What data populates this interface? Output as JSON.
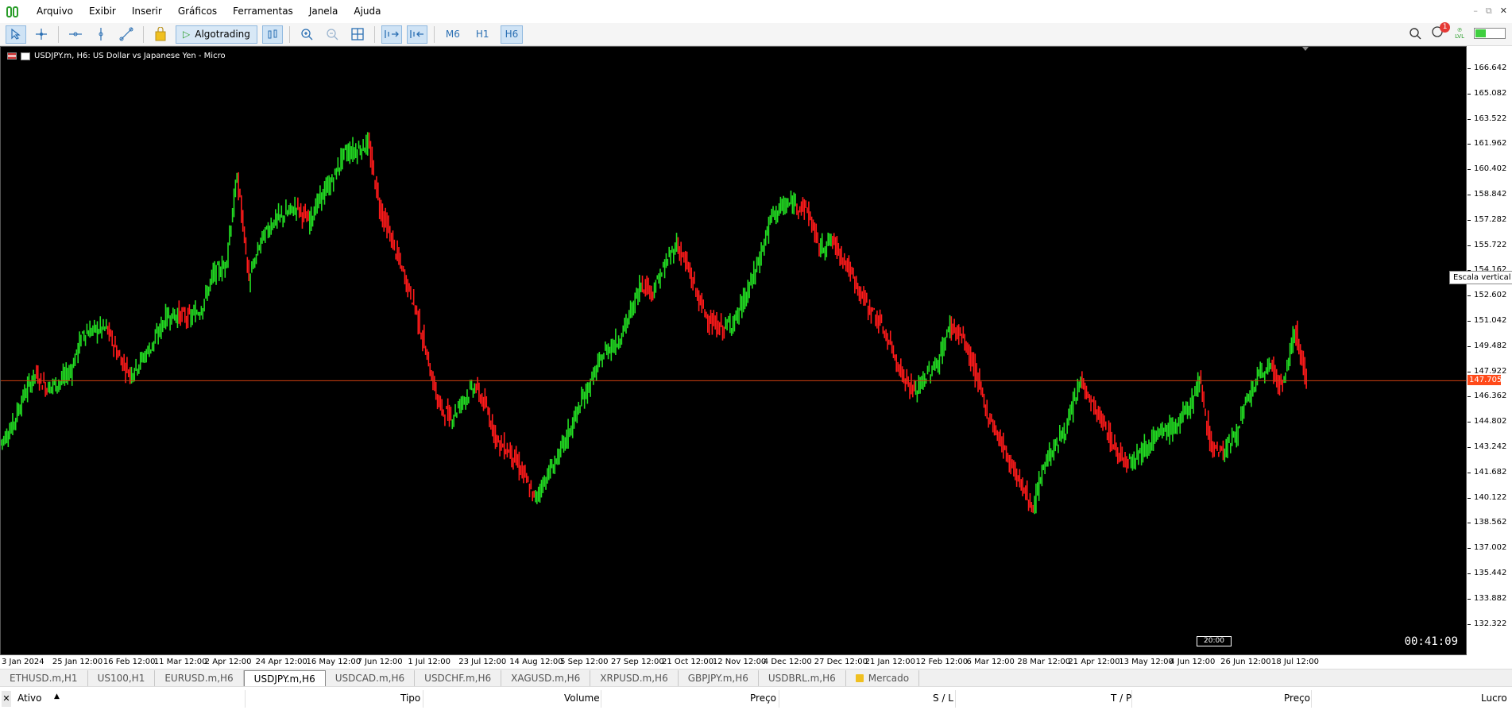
{
  "menubar": {
    "items": [
      "Arquivo",
      "Exibir",
      "Inserir",
      "Gráficos",
      "Ferramentas",
      "Janela",
      "Ajuda"
    ]
  },
  "toolbar": {
    "algotrading_label": "Algotrading",
    "timeframes": [
      "M6",
      "H1",
      "H6"
    ],
    "active_timeframe": "H6",
    "notification_count": "1",
    "lvl_label": "LVL",
    "battery_level": 0.35
  },
  "chart": {
    "title": "USDJPY.m, H6:  US Dollar vs Japanese Yen - Micro",
    "countdown": "00:41:09",
    "current_price": "147.705",
    "tooltip": "Escala vertical",
    "timeline_marker": "20:00",
    "bullish_color": "#22dd22",
    "bearish_color": "#ff1a1a",
    "price_line_color": "#d04010"
  },
  "price_scale": {
    "labels": [
      "166.642",
      "165.082",
      "163.522",
      "161.962",
      "160.402",
      "158.842",
      "157.282",
      "155.722",
      "154.162",
      "152.602",
      "151.042",
      "149.482",
      "147.922",
      "146.362",
      "144.802",
      "143.242",
      "141.682",
      "140.122",
      "138.562",
      "137.002",
      "135.442",
      "133.882",
      "132.322"
    ]
  },
  "time_axis": {
    "labels": [
      "3 Jan 2024",
      "25 Jan 12:00",
      "16 Feb 12:00",
      "11 Mar 12:00",
      "2 Apr 12:00",
      "24 Apr 12:00",
      "16 May 12:00",
      "7 Jun 12:00",
      "1 Jul 12:00",
      "23 Jul 12:00",
      "14 Aug 12:00",
      "5 Sep 12:00",
      "27 Sep 12:00",
      "21 Oct 12:00",
      "12 Nov 12:00",
      "4 Dec 12:00",
      "27 Dec 12:00",
      "21 Jan 12:00",
      "12 Feb 12:00",
      "6 Mar 12:00",
      "28 Mar 12:00",
      "21 Apr 12:00",
      "13 May 12:00",
      "4 Jun 12:00",
      "26 Jun 12:00",
      "18 Jul 12:00"
    ]
  },
  "tabs": {
    "items": [
      "ETHUSD.m,H1",
      "US100,H1",
      "EURUSD.m,H6",
      "USDJPY.m,H6",
      "USDCAD.m,H6",
      "USDCHF.m,H6",
      "XAGUSD.m,H6",
      "XRPUSD.m,H6",
      "GBPJPY.m,H6",
      "USDBRL.m,H6",
      "Mercado"
    ],
    "active": "USDJPY.m,H6"
  },
  "toolbox": {
    "columns": [
      "Ativo",
      "Tipo",
      "Volume",
      "Preço",
      "S / L",
      "T / P",
      "Preço",
      "Lucro"
    ],
    "sort_indicator": "▲"
  },
  "chart_data": {
    "type": "line",
    "symbol": "USDJPY.m",
    "timeframe": "H6",
    "ylim": [
      131.542,
      167.422
    ],
    "current_price": 147.705,
    "series": [
      {
        "values": [
          144.0,
          144.9,
          146.8,
          148.1,
          147.3,
          147.6,
          148.3,
          150.5,
          150.7,
          150.8,
          149.2,
          148.1,
          149.0,
          150.0,
          151.5,
          151.6,
          151.4,
          152.0,
          154.0,
          154.5,
          159.8,
          153.6,
          156.0,
          157.1,
          157.5,
          158.0,
          157.1,
          158.5,
          159.5,
          161.2,
          161.3,
          161.7,
          158.0,
          156.0,
          154.0,
          152.0,
          149.0,
          146.2,
          145.5,
          146.6,
          147.4,
          146.0,
          144.0,
          143.5,
          142.3,
          140.7,
          142.0,
          143.2,
          144.8,
          146.5,
          148.0,
          149.5,
          150.0,
          151.5,
          153.5,
          153.0,
          154.5,
          155.8,
          154.2,
          152.2,
          151.0,
          150.8,
          151.4,
          153.0,
          155.0,
          157.5,
          158.0,
          158.2,
          157.8,
          155.5,
          156.0,
          155.0,
          153.5,
          152.2,
          151.2,
          149.8,
          148.0,
          147.0,
          148.0,
          148.8,
          151.0,
          150.3,
          148.5,
          146.0,
          144.5,
          143.0,
          141.5,
          140.2,
          143.0,
          144.0,
          145.3,
          147.8,
          146.2,
          145.0,
          143.5,
          143.0,
          143.5,
          144.2,
          144.7,
          145.0,
          146.0,
          147.7,
          143.8,
          143.5,
          144.5,
          146.5,
          148.0,
          148.6,
          147.2,
          150.8,
          147.7
        ]
      }
    ]
  }
}
